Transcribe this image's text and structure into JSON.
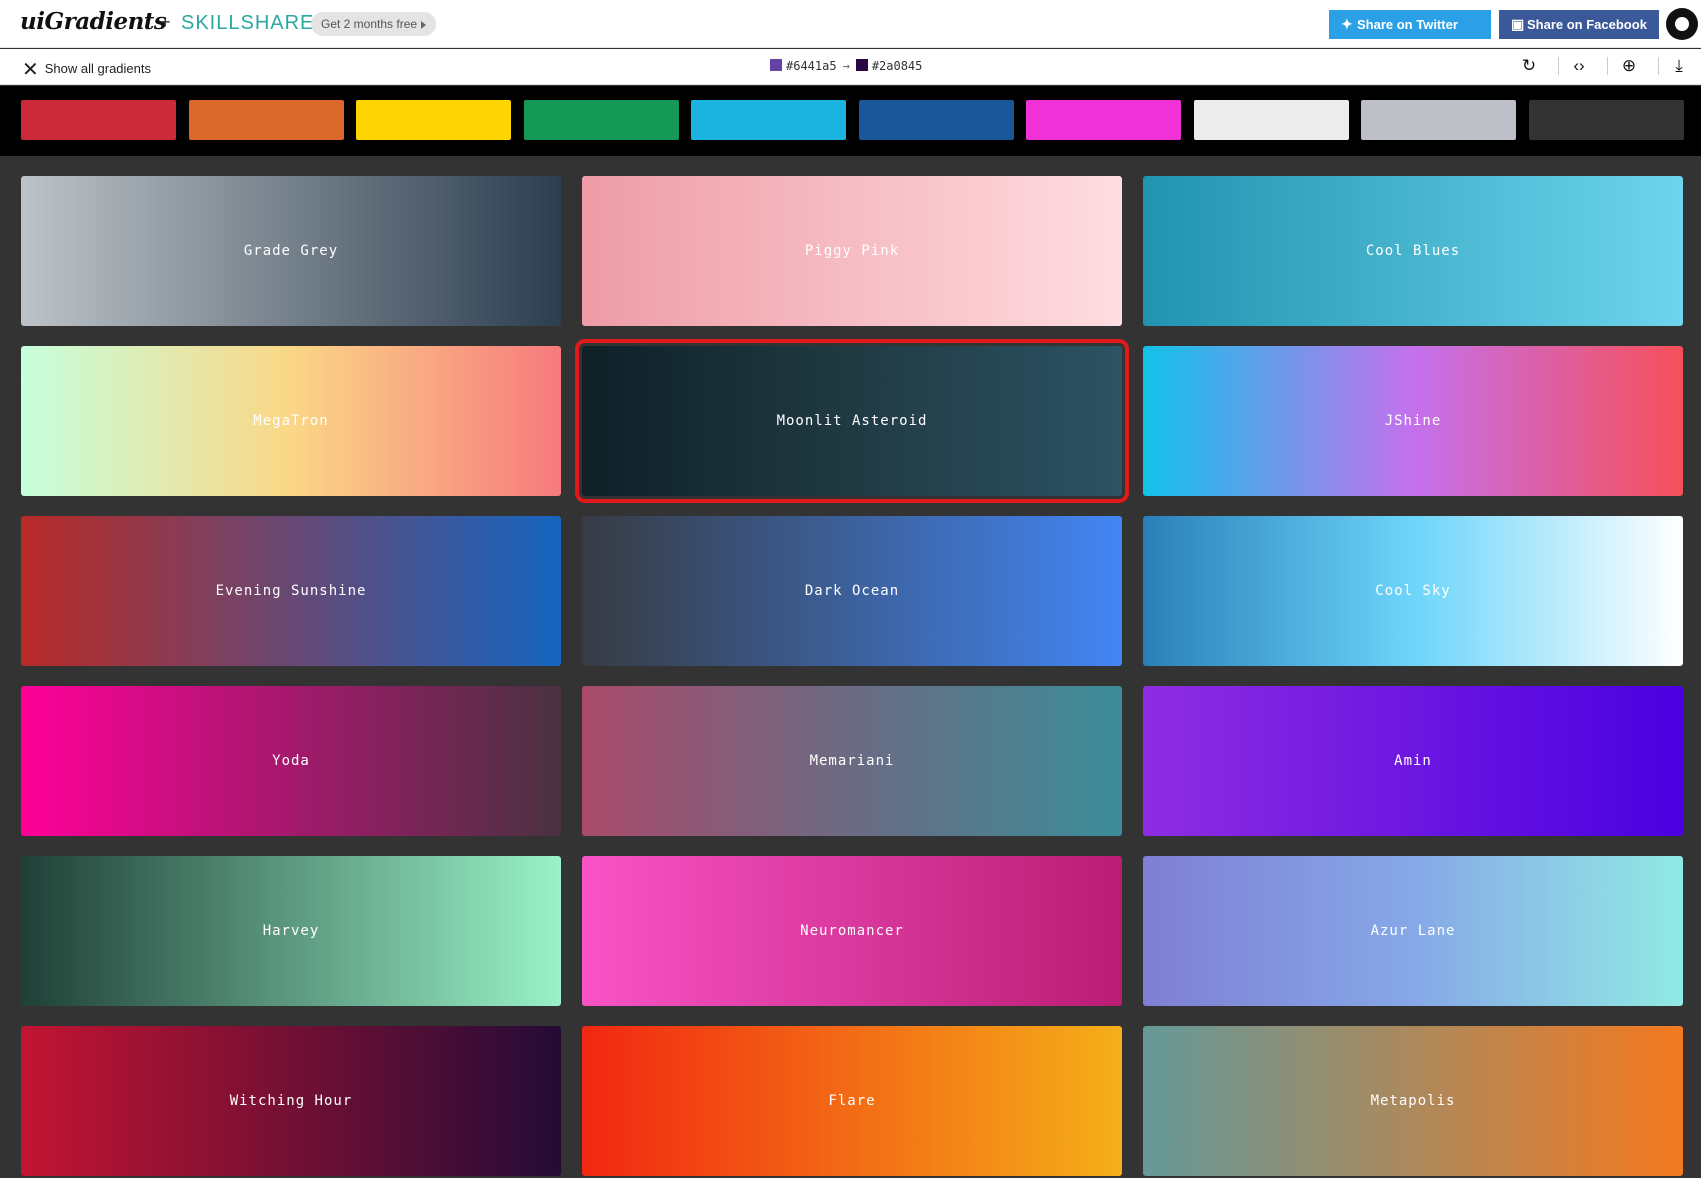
{
  "header": {
    "logo": "uiGradients",
    "plus": "+",
    "partner": "SKILLSHARE",
    "promo": "Get 2 months free",
    "share_twitter": "Share on Twitter",
    "share_facebook": "Share on Facebook"
  },
  "toolbar": {
    "show_all": "Show all gradients",
    "color_from": "#6441a5",
    "color_to": "#2a0845",
    "arrow": "→"
  },
  "filters": [
    "#cc2a3b",
    "#d9682a",
    "#fed402",
    "#159957",
    "#1bb3df",
    "#1a579a",
    "#f032d8",
    "#ececec",
    "#bec0c8",
    "#333333"
  ],
  "gradients": [
    {
      "name": "Grade Grey",
      "from": "#bdc3c7",
      "to": "#2c3e50"
    },
    {
      "name": "Piggy Pink",
      "from": "#ee9ca7",
      "to": "#ffdde1"
    },
    {
      "name": "Cool Blues",
      "from": "#2193b0",
      "to": "#6dd5ed"
    },
    {
      "name": "MegaTron",
      "from": "#c6ffdd",
      "via": "#fbd786",
      "to": "#f7797d"
    },
    {
      "name": "Moonlit Asteroid",
      "from": "#0f2027",
      "via": "#203a43",
      "to": "#2c5364",
      "selected": true
    },
    {
      "name": "JShine",
      "from": "#12c2e9",
      "via": "#c471ed",
      "to": "#f64f59"
    },
    {
      "name": "Evening Sunshine",
      "from": "#b92b27",
      "to": "#1565c0"
    },
    {
      "name": "Dark Ocean",
      "from": "#373b44",
      "to": "#4286f4"
    },
    {
      "name": "Cool Sky",
      "from": "#2980b9",
      "via": "#6dd5fa",
      "to": "#ffffff"
    },
    {
      "name": "Yoda",
      "from": "#ff0099",
      "to": "#493240"
    },
    {
      "name": "Memariani",
      "from": "#aa4b6b",
      "via": "#6b6b83",
      "to": "#3b8d99"
    },
    {
      "name": "Amin",
      "from": "#8e2de2",
      "to": "#4a00e0"
    },
    {
      "name": "Harvey",
      "from": "#1f4037",
      "to": "#99f2c8"
    },
    {
      "name": "Neuromancer",
      "from": "#f953c6",
      "to": "#b91d73"
    },
    {
      "name": "Azur Lane",
      "from": "#7f7fd5",
      "via": "#86a8e7",
      "to": "#91eae4"
    },
    {
      "name": "Witching Hour",
      "from": "#c31432",
      "to": "#240b36"
    },
    {
      "name": "Flare",
      "from": "#f12711",
      "to": "#f5af19"
    },
    {
      "name": "Metapolis",
      "from": "#659999",
      "to": "#f4791f"
    }
  ]
}
